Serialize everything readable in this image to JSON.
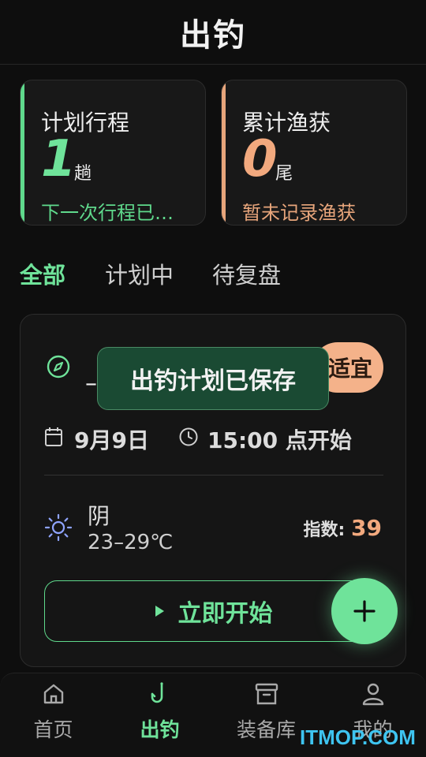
{
  "header": {
    "title": "出钓"
  },
  "stats": {
    "trips": {
      "label": "计划行程",
      "value": "1",
      "unit": "趟",
      "sub": "下一次行程已…"
    },
    "catch": {
      "label": "累计渔获",
      "value": "0",
      "unit": "尾",
      "sub": "暂未记录渔获"
    }
  },
  "tabs": [
    {
      "label": "全部",
      "active": true
    },
    {
      "label": "计划中",
      "active": false
    },
    {
      "label": "待复盘",
      "active": false
    }
  ],
  "plan": {
    "spot_name": "–",
    "suitability": "适宜",
    "date": "9月9日",
    "start_time": "15:00 点开始",
    "weather": "阴",
    "temperature": "23–29℃",
    "index_label": "指数:",
    "index_value": "39",
    "start_button": "立即开始"
  },
  "toast": "出钓计划已保存",
  "nav": [
    {
      "label": "首页",
      "icon": "home-icon"
    },
    {
      "label": "出钓",
      "icon": "fishhook-icon",
      "active": true
    },
    {
      "label": "装备库",
      "icon": "archive-icon"
    },
    {
      "label": "我的",
      "icon": "user-icon"
    }
  ],
  "watermark": "ITMOP.COM",
  "colors": {
    "accent_green": "#6fe39a",
    "accent_orange": "#f2a97e",
    "toast_bg": "#1a4a33"
  }
}
